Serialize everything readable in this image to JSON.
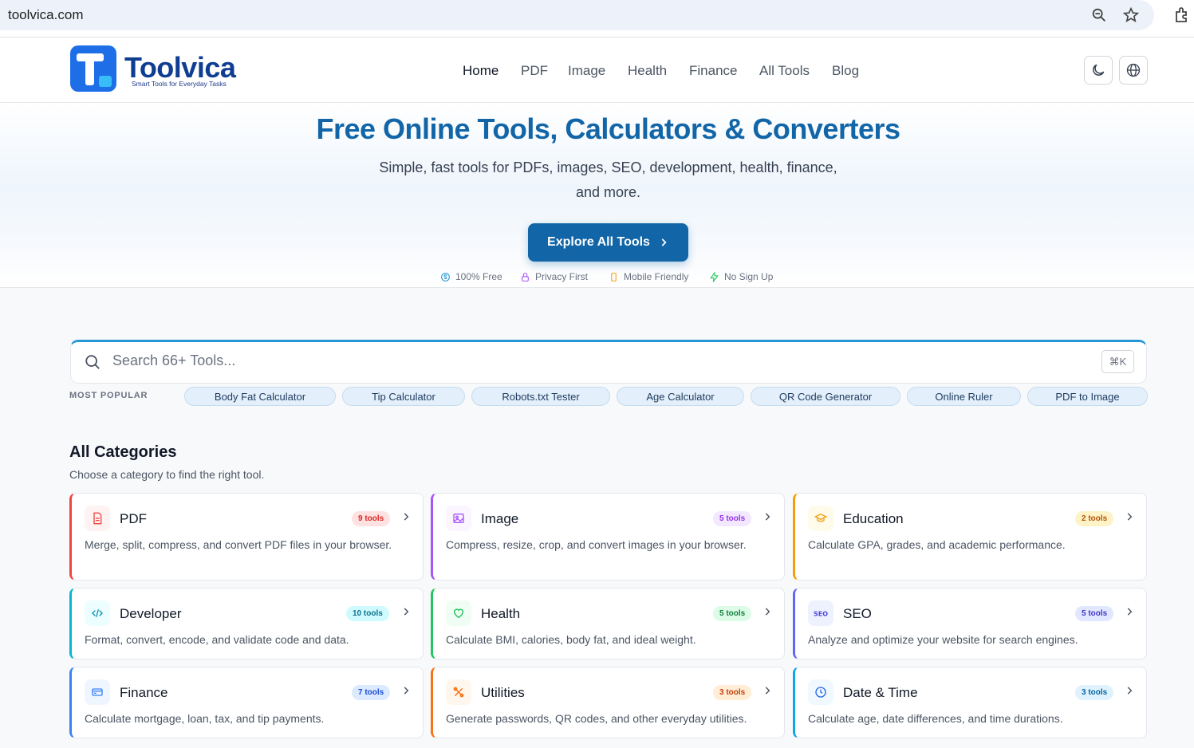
{
  "browser": {
    "url": "toolvica.com"
  },
  "header": {
    "logo_name": "Toolvica",
    "logo_tagline": "Smart Tools for Everyday Tasks",
    "nav": [
      "Home",
      "PDF",
      "Image",
      "Health",
      "Finance",
      "All Tools",
      "Blog"
    ],
    "active_nav": "Home"
  },
  "hero": {
    "title": "Free Online Tools, Calculators & Converters",
    "subtitle_line1": "Simple, fast tools for PDFs, images, SEO, development, health, finance,",
    "subtitle_line2": "and more.",
    "cta": "Explore All Tools",
    "features": [
      "100% Free",
      "Privacy First",
      "Mobile Friendly",
      "No Sign Up"
    ]
  },
  "search": {
    "placeholder": "Search 66+ Tools...",
    "shortcut": "⌘K",
    "popular_label": "MOST POPULAR",
    "popular": [
      "Body Fat Calculator",
      "Tip Calculator",
      "Robots.txt Tester",
      "Age Calculator",
      "QR Code Generator",
      "Online Ruler",
      "PDF to Image"
    ]
  },
  "categories": {
    "heading": "All Categories",
    "subheading": "Choose a category to find the right tool.",
    "items": [
      {
        "name": "PDF",
        "count": "9 tools",
        "desc": "Merge, split, compress, and convert PDF files in your browser.",
        "icon": "file-icon",
        "color": "#ef4444"
      },
      {
        "name": "Image",
        "count": "5 tools",
        "desc": "Compress, resize, crop, and convert images in your browser.",
        "icon": "image-icon",
        "color": "#a855f7"
      },
      {
        "name": "Education",
        "count": "2 tools",
        "desc": "Calculate GPA, grades, and academic performance.",
        "icon": "graduation-cap-icon",
        "color": "#f59e0b"
      },
      {
        "name": "Developer",
        "count": "10 tools",
        "desc": "Format, convert, encode, and validate code and data.",
        "icon": "code-icon",
        "color": "#06b6d4"
      },
      {
        "name": "Health",
        "count": "5 tools",
        "desc": "Calculate BMI, calories, body fat, and ideal weight.",
        "icon": "heart-icon",
        "color": "#22c55e"
      },
      {
        "name": "SEO",
        "count": "5 tools",
        "desc": "Analyze and optimize your website for search engines.",
        "icon": "seo-icon",
        "color": "#6366f1"
      },
      {
        "name": "Finance",
        "count": "7 tools",
        "desc": "Calculate mortgage, loan, tax, and tip payments.",
        "icon": "credit-card-icon",
        "color": "#3b82f6"
      },
      {
        "name": "Utilities",
        "count": "3 tools",
        "desc": "Generate passwords, QR codes, and other everyday utilities.",
        "icon": "tools-icon",
        "color": "#f97316"
      },
      {
        "name": "Date & Time",
        "count": "3 tools",
        "desc": "Calculate age, date differences, and time durations.",
        "icon": "clock-icon",
        "color": "#0ea5e9"
      }
    ]
  }
}
